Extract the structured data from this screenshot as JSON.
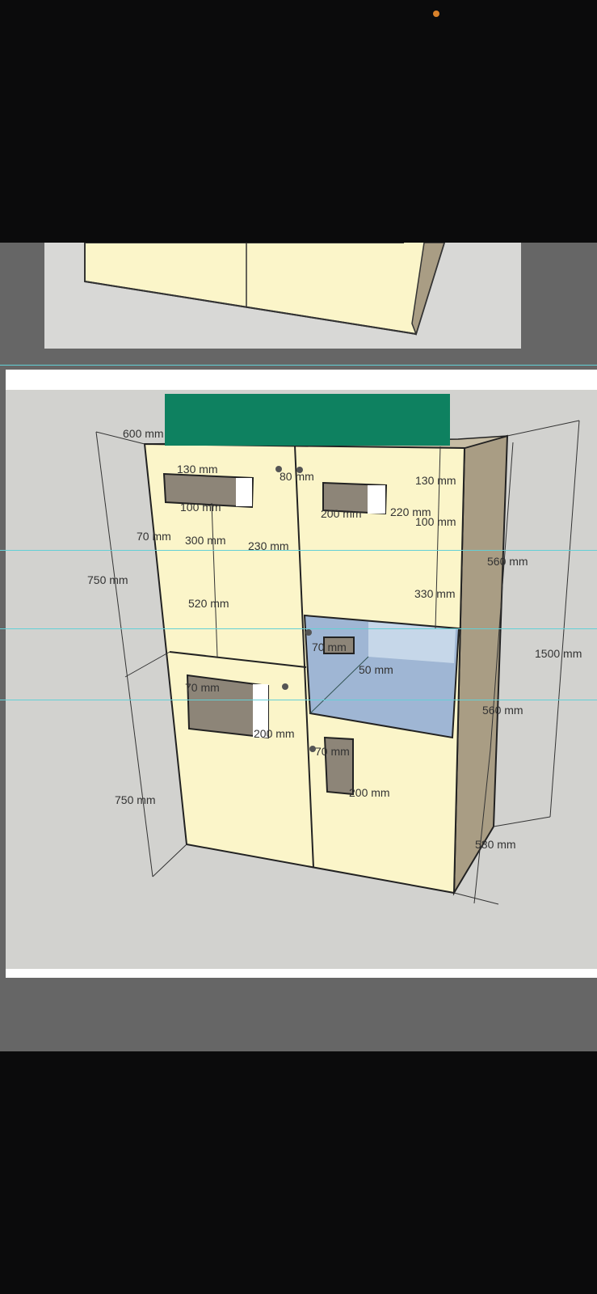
{
  "status_bar": {
    "dot_color": "#d9822b"
  },
  "colors": {
    "cabinet_front": "#fbf5c9",
    "cabinet_side": "#a99d84",
    "cutout": "#8d8578",
    "glass": "#9fb6d4",
    "accent_green": "#0e8160",
    "guide_line": "#63d0d6"
  },
  "drawing": {
    "dimensions": {
      "top_width": "600 mm",
      "upper_left_top": "130 mm",
      "upper_center_top": "80 mm",
      "upper_right_top": "130 mm",
      "upper_left_slot_width": "100 mm",
      "upper_right_slot_width": "200 mm",
      "upper_right_offset": "220 mm",
      "upper_right_slot_height": "100 mm",
      "left_small": "70 mm",
      "left_slot_length": "300 mm",
      "center_small": "230 mm",
      "upper_right_side": "560 mm",
      "left_upper_height": "750 mm",
      "left_mid": "520 mm",
      "right_mid": "330 mm",
      "total_height": "1500 mm",
      "window_top": "70 mm",
      "window_slot": "50 mm",
      "lower_left_top": "70 mm",
      "lower_right_side": "560 mm",
      "lower_left_slot": "200 mm",
      "lower_right_top": "70 mm",
      "lower_right_slot": "200 mm",
      "left_lower_height": "750 mm",
      "depth": "580 mm"
    }
  }
}
